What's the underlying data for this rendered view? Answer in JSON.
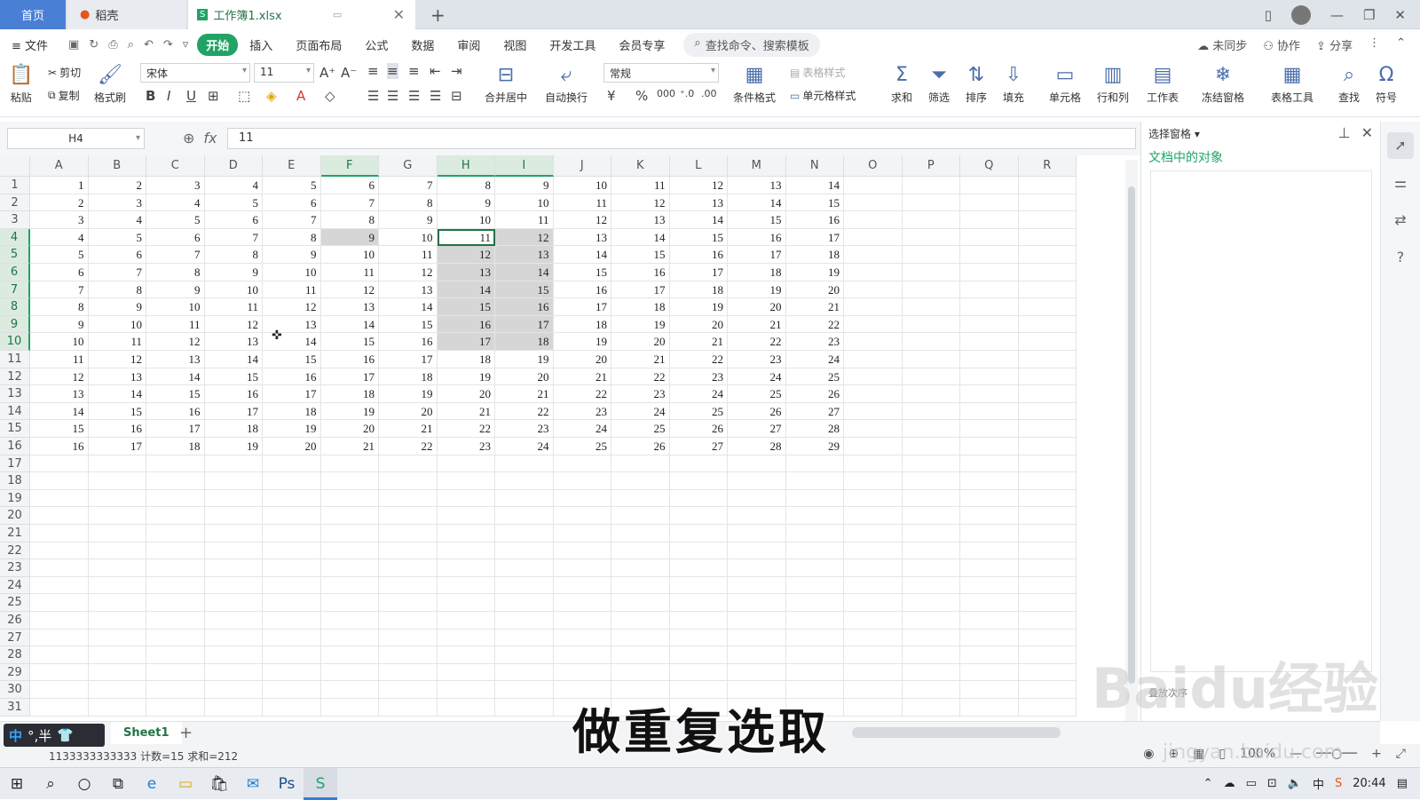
{
  "tabs": {
    "home": "首页",
    "doc": "稻壳",
    "file": "工作簿1.xlsx"
  },
  "menu": {
    "file": "文件",
    "items": [
      "开始",
      "插入",
      "页面布局",
      "公式",
      "数据",
      "审阅",
      "视图",
      "开发工具",
      "会员专享"
    ],
    "search": "查找命令、搜索模板",
    "unsync": "未同步",
    "collab": "协作",
    "share": "分享"
  },
  "ribbon": {
    "paste": "粘贴",
    "cut": "剪切",
    "copy": "复制",
    "format_painter": "格式刷",
    "font_name": "宋体",
    "font_size": "11",
    "number_format": "常规",
    "merge": "合并居中",
    "wrap": "自动换行",
    "cond_format": "条件格式",
    "table_style": "表格样式",
    "cell_style": "单元格样式",
    "sum": "求和",
    "filter": "筛选",
    "sort": "排序",
    "fill": "填充",
    "cell": "单元格",
    "rowcol": "行和列",
    "worksheet": "工作表",
    "freeze": "冻结窗格",
    "table_tools": "表格工具",
    "find": "查找",
    "symbol": "符号"
  },
  "formula": {
    "name_box": "H4",
    "value": "11"
  },
  "columns": [
    "A",
    "B",
    "C",
    "D",
    "E",
    "F",
    "G",
    "H",
    "I",
    "J",
    "K",
    "L",
    "M",
    "N",
    "O",
    "P",
    "Q",
    "R"
  ],
  "rows": [
    "1",
    "2",
    "3",
    "4",
    "5",
    "6",
    "7",
    "8",
    "9",
    "10",
    "11",
    "12",
    "13",
    "14",
    "15",
    "16",
    "17",
    "18",
    "19",
    "20",
    "21",
    "22",
    "23",
    "24",
    "25",
    "26",
    "27",
    "28",
    "29",
    "30",
    "31"
  ],
  "pane": {
    "title": "选择窗格",
    "subtitle": "文档中的对象",
    "footer": "叠放次序"
  },
  "sheet": {
    "tab": "Sheet1"
  },
  "status": {
    "text": "1133333333333 计数=15 求和=212",
    "zoom": "100%"
  },
  "ime": {
    "lang": "中",
    "mode": "°,半"
  },
  "caption": "做重复选取",
  "watermark": {
    "logo": "Baidu经验",
    "url": "jingyan.baidu.com"
  },
  "taskbar": {
    "time": "20:44"
  }
}
